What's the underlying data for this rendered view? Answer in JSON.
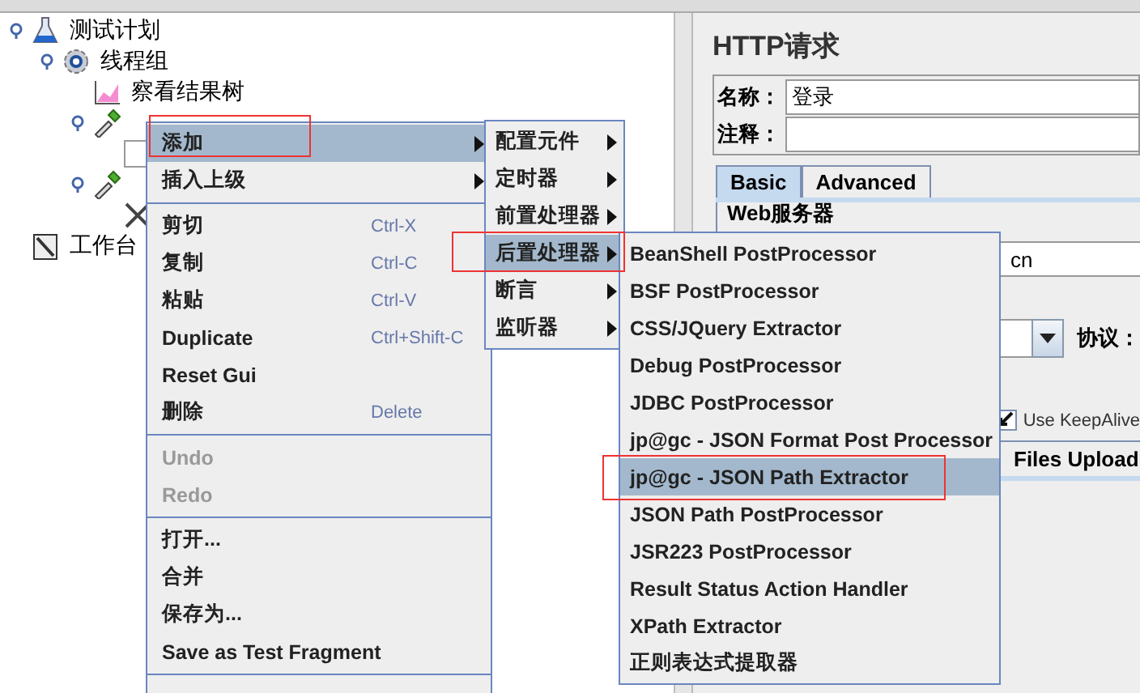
{
  "tree": [
    {
      "label": "测试计划",
      "kind": "plan",
      "children": [
        {
          "label": "线程组",
          "kind": "thread-group",
          "children": [
            {
              "label": "察看结果树",
              "kind": "listener"
            },
            {
              "kind": "sampler",
              "children": [
                {
                  "kind": "config"
                }
              ]
            },
            {
              "kind": "sampler",
              "children": [
                {
                  "kind": "tool"
                }
              ]
            }
          ]
        }
      ]
    },
    {
      "label": "工作台",
      "kind": "workbench"
    }
  ],
  "panel": {
    "title": "HTTP请求",
    "name_label": "名称：",
    "name_value": "登录",
    "comment_label": "注释：",
    "tabs": [
      {
        "label": "Basic",
        "selected": true
      },
      {
        "label": "Advanced",
        "selected": false
      }
    ],
    "group_title": "Web服务器",
    "server_value": "cn",
    "protocol_label": "协议：",
    "keepalive": {
      "label": "Use KeepAlive",
      "checked": true
    },
    "upload_tab": "Files Upload"
  },
  "context_menu": {
    "items": [
      {
        "kind": "item",
        "label": "添加",
        "submenu": true,
        "selected": true
      },
      {
        "kind": "item",
        "label": "插入上级",
        "submenu": true,
        "selected": false
      },
      {
        "kind": "separator"
      },
      {
        "kind": "item",
        "label": "剪切",
        "shortcut": "Ctrl-X",
        "selected": false
      },
      {
        "kind": "item",
        "label": "复制",
        "shortcut": "Ctrl-C",
        "selected": false
      },
      {
        "kind": "item",
        "label": "粘贴",
        "shortcut": "Ctrl-V",
        "selected": false
      },
      {
        "kind": "item",
        "label": "Duplicate",
        "shortcut": "Ctrl+Shift-C",
        "selected": false
      },
      {
        "kind": "item",
        "label": "Reset Gui",
        "selected": false
      },
      {
        "kind": "item",
        "label": "删除",
        "shortcut": "Delete",
        "selected": false
      },
      {
        "kind": "separator"
      },
      {
        "kind": "item",
        "label": "Undo",
        "disabled": true,
        "selected": false
      },
      {
        "kind": "item",
        "label": "Redo",
        "disabled": true,
        "selected": false
      },
      {
        "kind": "separator"
      },
      {
        "kind": "item",
        "label": "打开...",
        "selected": false
      },
      {
        "kind": "item",
        "label": "合并",
        "selected": false
      },
      {
        "kind": "item",
        "label": "保存为...",
        "selected": false
      },
      {
        "kind": "item",
        "label": "Save as Test Fragment",
        "selected": false
      },
      {
        "kind": "separator"
      }
    ]
  },
  "submenu": {
    "items": [
      {
        "label": "配置元件",
        "submenu": true,
        "selected": false
      },
      {
        "label": "定时器",
        "submenu": true,
        "selected": false
      },
      {
        "label": "前置处理器",
        "submenu": true,
        "selected": false
      },
      {
        "label": "后置处理器",
        "submenu": true,
        "selected": true
      },
      {
        "label": "断言",
        "submenu": true,
        "selected": false
      },
      {
        "label": "监听器",
        "submenu": true,
        "selected": false
      }
    ]
  },
  "postprocessor_menu": {
    "items": [
      {
        "label": "BeanShell PostProcessor",
        "selected": false
      },
      {
        "label": "BSF PostProcessor",
        "selected": false
      },
      {
        "label": "CSS/JQuery Extractor",
        "selected": false
      },
      {
        "label": "Debug PostProcessor",
        "selected": false
      },
      {
        "label": "JDBC PostProcessor",
        "selected": false
      },
      {
        "label": "jp@gc - JSON Format Post Processor",
        "selected": false
      },
      {
        "label": "jp@gc - JSON Path Extractor",
        "selected": true
      },
      {
        "label": "JSON Path PostProcessor",
        "selected": false
      },
      {
        "label": "JSR223 PostProcessor",
        "selected": false
      },
      {
        "label": "Result Status Action Handler",
        "selected": false
      },
      {
        "label": "XPath Extractor",
        "selected": false
      },
      {
        "label": "正则表达式提取器",
        "selected": false
      }
    ]
  }
}
